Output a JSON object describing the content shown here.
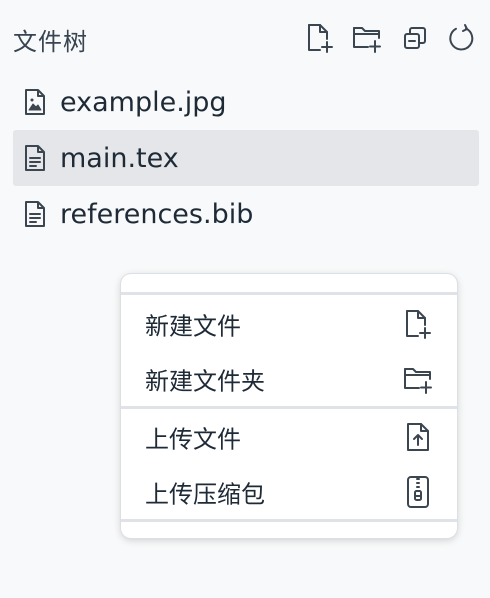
{
  "sidebar": {
    "title": "文件树",
    "header_actions": [
      {
        "name": "new-file-icon",
        "action": "新建文件"
      },
      {
        "name": "new-folder-icon",
        "action": "新建文件夹"
      },
      {
        "name": "collapse-all-icon",
        "action": "折叠"
      },
      {
        "name": "refresh-icon",
        "action": "刷新"
      }
    ],
    "files": [
      {
        "label": "example.jpg",
        "icon": "image-file-icon",
        "selected": false
      },
      {
        "label": "main.tex",
        "icon": "text-file-icon",
        "selected": true
      },
      {
        "label": "references.bib",
        "icon": "text-file-icon",
        "selected": false
      }
    ]
  },
  "context_menu": {
    "items": [
      {
        "label": "新建文件",
        "icon": "new-file-icon"
      },
      {
        "label": "新建文件夹",
        "icon": "new-folder-icon"
      },
      {
        "label": "上传文件",
        "icon": "upload-file-icon"
      },
      {
        "label": "上传压缩包",
        "icon": "zip-archive-icon"
      }
    ]
  },
  "colors": {
    "background": "#f8f9fa",
    "selected_row": "#e4e6ea",
    "text": "#1e2a36",
    "icon": "#3c4650",
    "menu_bg": "#ffffff",
    "separator": "#dfe2e6"
  }
}
